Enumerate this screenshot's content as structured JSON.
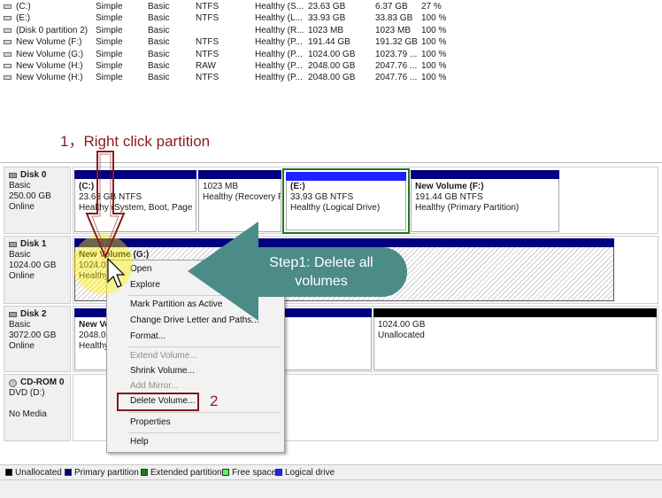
{
  "volume_list": {
    "rows": [
      {
        "volume": "(C:)",
        "layout": "Simple",
        "type": "Basic",
        "fs": "NTFS",
        "status": "Healthy (S...",
        "capacity": "23.63 GB",
        "free": "6.37 GB",
        "pct": "27 %"
      },
      {
        "volume": "(E:)",
        "layout": "Simple",
        "type": "Basic",
        "fs": "NTFS",
        "status": "Healthy (L...",
        "capacity": "33.93 GB",
        "free": "33.83 GB",
        "pct": "100 %"
      },
      {
        "volume": "(Disk 0 partition 2)",
        "layout": "Simple",
        "type": "Basic",
        "fs": "",
        "status": "Healthy (R...",
        "capacity": "1023 MB",
        "free": "1023 MB",
        "pct": "100 %"
      },
      {
        "volume": "New Volume (F:)",
        "layout": "Simple",
        "type": "Basic",
        "fs": "NTFS",
        "status": "Healthy (P...",
        "capacity": "191.44 GB",
        "free": "191.32 GB",
        "pct": "100 %"
      },
      {
        "volume": "New Volume (G:)",
        "layout": "Simple",
        "type": "Basic",
        "fs": "NTFS",
        "status": "Healthy (P...",
        "capacity": "1024.00 GB",
        "free": "1023.79 ...",
        "pct": "100 %"
      },
      {
        "volume": "New Volume (H:)",
        "layout": "Simple",
        "type": "Basic",
        "fs": "RAW",
        "status": "Healthy (P...",
        "capacity": "2048.00 GB",
        "free": "2047.76 ...",
        "pct": "100 %"
      },
      {
        "volume": "New Volume (H:)",
        "layout": "Simple",
        "type": "Basic",
        "fs": "NTFS",
        "status": "Healthy (P...",
        "capacity": "2048.00 GB",
        "free": "2047.76 ...",
        "pct": "100 %"
      }
    ]
  },
  "graphical": {
    "disks": [
      {
        "name": "Disk 0",
        "type": "Basic",
        "size": "250.00 GB",
        "state": "Online",
        "partitions": [
          {
            "name": "(C:)",
            "size": "23.63 GB NTFS",
            "status": "Healthy (System, Boot, Page Fi"
          },
          {
            "name": "",
            "size": "1023 MB",
            "status": "Healthy (Recovery P"
          },
          {
            "name": "(E:)",
            "size": "33.93 GB NTFS",
            "status": "Healthy (Logical Drive)"
          },
          {
            "name": "New Volume  (F:)",
            "size": "191.44 GB NTFS",
            "status": "Healthy (Primary Partition)"
          }
        ]
      },
      {
        "name": "Disk 1",
        "type": "Basic",
        "size": "1024.00 GB",
        "state": "Online",
        "partitions": [
          {
            "name": "New Volume  (G:)",
            "size": "1024.00",
            "status": "Healthy"
          }
        ]
      },
      {
        "name": "Disk 2",
        "type": "Basic",
        "size": "3072.00 GB",
        "state": "Online",
        "partitions": [
          {
            "name": "New Vo",
            "size": "2048.00",
            "status": "Healthy"
          },
          {
            "name": "",
            "size": "1024.00 GB",
            "status": "Unallocated"
          }
        ]
      },
      {
        "name": "CD-ROM 0",
        "type": "DVD (D:)",
        "size": "",
        "state": "No Media",
        "partitions": []
      }
    ]
  },
  "legend": {
    "items": [
      {
        "label": "Unallocated",
        "color": "#000000"
      },
      {
        "label": "Primary partition",
        "color": "#00007e"
      },
      {
        "label": "Extended partition",
        "color": "#1d7a1d"
      },
      {
        "label": "Free space",
        "color": "#5cf25c"
      },
      {
        "label": "Logical drive",
        "color": "#1f1fff"
      }
    ]
  },
  "context_menu": {
    "open": "Open",
    "explore": "Explore",
    "mark_active": "Mark Partition as Active",
    "change_letter": "Change Drive Letter and Paths...",
    "format": "Format...",
    "extend": "Extend Volume...",
    "shrink": "Shrink Volume...",
    "add_mirror": "Add Mirror...",
    "delete": "Delete Volume...",
    "properties": "Properties",
    "help": "Help"
  },
  "annotations": {
    "step_one_hint": "1，Right click partition",
    "step_label_line1": "Step1: Delete all",
    "step_label_line2": "volumes",
    "number_two": "2",
    "arrow_color": "#4b8b88",
    "marker_color": "#8a1c1c"
  }
}
